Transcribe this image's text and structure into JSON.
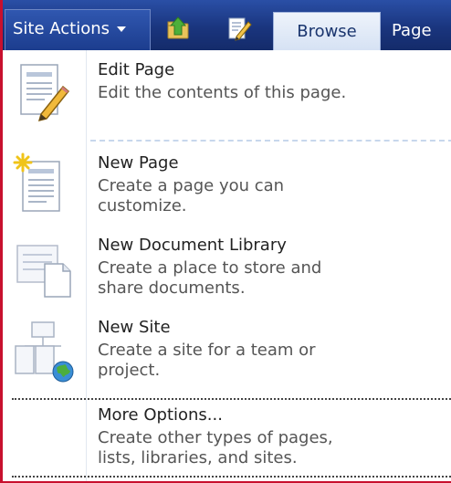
{
  "ribbon": {
    "site_actions_label": "Site Actions",
    "browse_tab_label": "Browse",
    "page_tab_label": "Page",
    "colors": {
      "bar": "#1a357e",
      "active_tab": "#d6e2f4",
      "frame_border": "#c8102e"
    }
  },
  "menu": {
    "items": [
      {
        "title": "Edit Page",
        "desc_line1": "Edit the contents of this page.",
        "desc_line2": "",
        "icon": "edit-page-icon"
      },
      {
        "title": "New Page",
        "desc_line1": "Create a page you can",
        "desc_line2": "customize.",
        "icon": "new-page-icon"
      },
      {
        "title": "New Document Library",
        "desc_line1": "Create a place to store and",
        "desc_line2": "share documents.",
        "icon": "new-document-library-icon"
      },
      {
        "title": "New Site",
        "desc_line1": "Create a site for a team or",
        "desc_line2": "project.",
        "icon": "new-site-icon"
      },
      {
        "title": "More Options...",
        "desc_line1": "Create other types of pages,",
        "desc_line2": "lists, libraries, and sites.",
        "icon": ""
      }
    ]
  }
}
